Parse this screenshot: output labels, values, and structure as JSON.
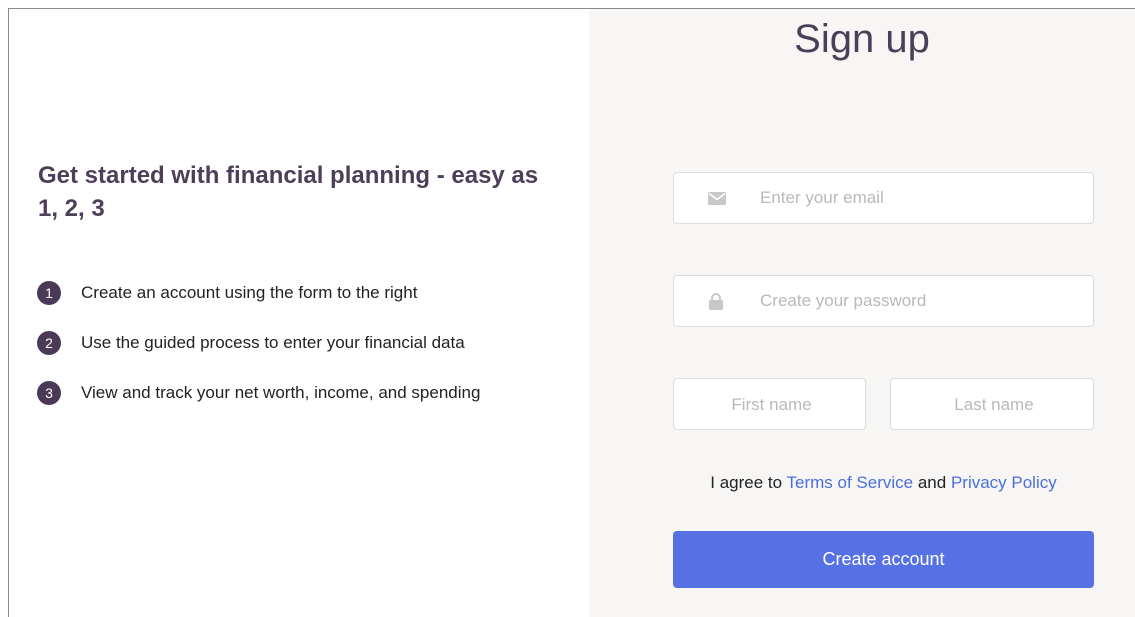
{
  "left": {
    "headline": "Get started with financial planning - easy as 1, 2, 3",
    "steps": [
      {
        "num": "1",
        "text": "Create an account using the form to the right"
      },
      {
        "num": "2",
        "text": "Use the guided process to enter your financial data"
      },
      {
        "num": "3",
        "text": "View and track your net worth, income, and spending"
      }
    ]
  },
  "form": {
    "title": "Sign up",
    "email": {
      "icon": "envelope-icon",
      "placeholder": "Enter your email",
      "value": ""
    },
    "password": {
      "icon": "lock-icon",
      "placeholder": "Create your password",
      "value": ""
    },
    "first_name": {
      "placeholder": "First name",
      "value": ""
    },
    "last_name": {
      "placeholder": "Last name",
      "value": ""
    },
    "agree": {
      "prefix": "I agree to",
      "terms_link": "Terms of Service",
      "conjunction": "and",
      "privacy_link": "Privacy Policy"
    },
    "submit_label": "Create account"
  },
  "colors": {
    "accent": "#5671e4",
    "link": "#4b6fd8",
    "heading": "#4d3f5a",
    "step_badge": "#4a3a58",
    "form_bg": "#f7f6f5"
  }
}
